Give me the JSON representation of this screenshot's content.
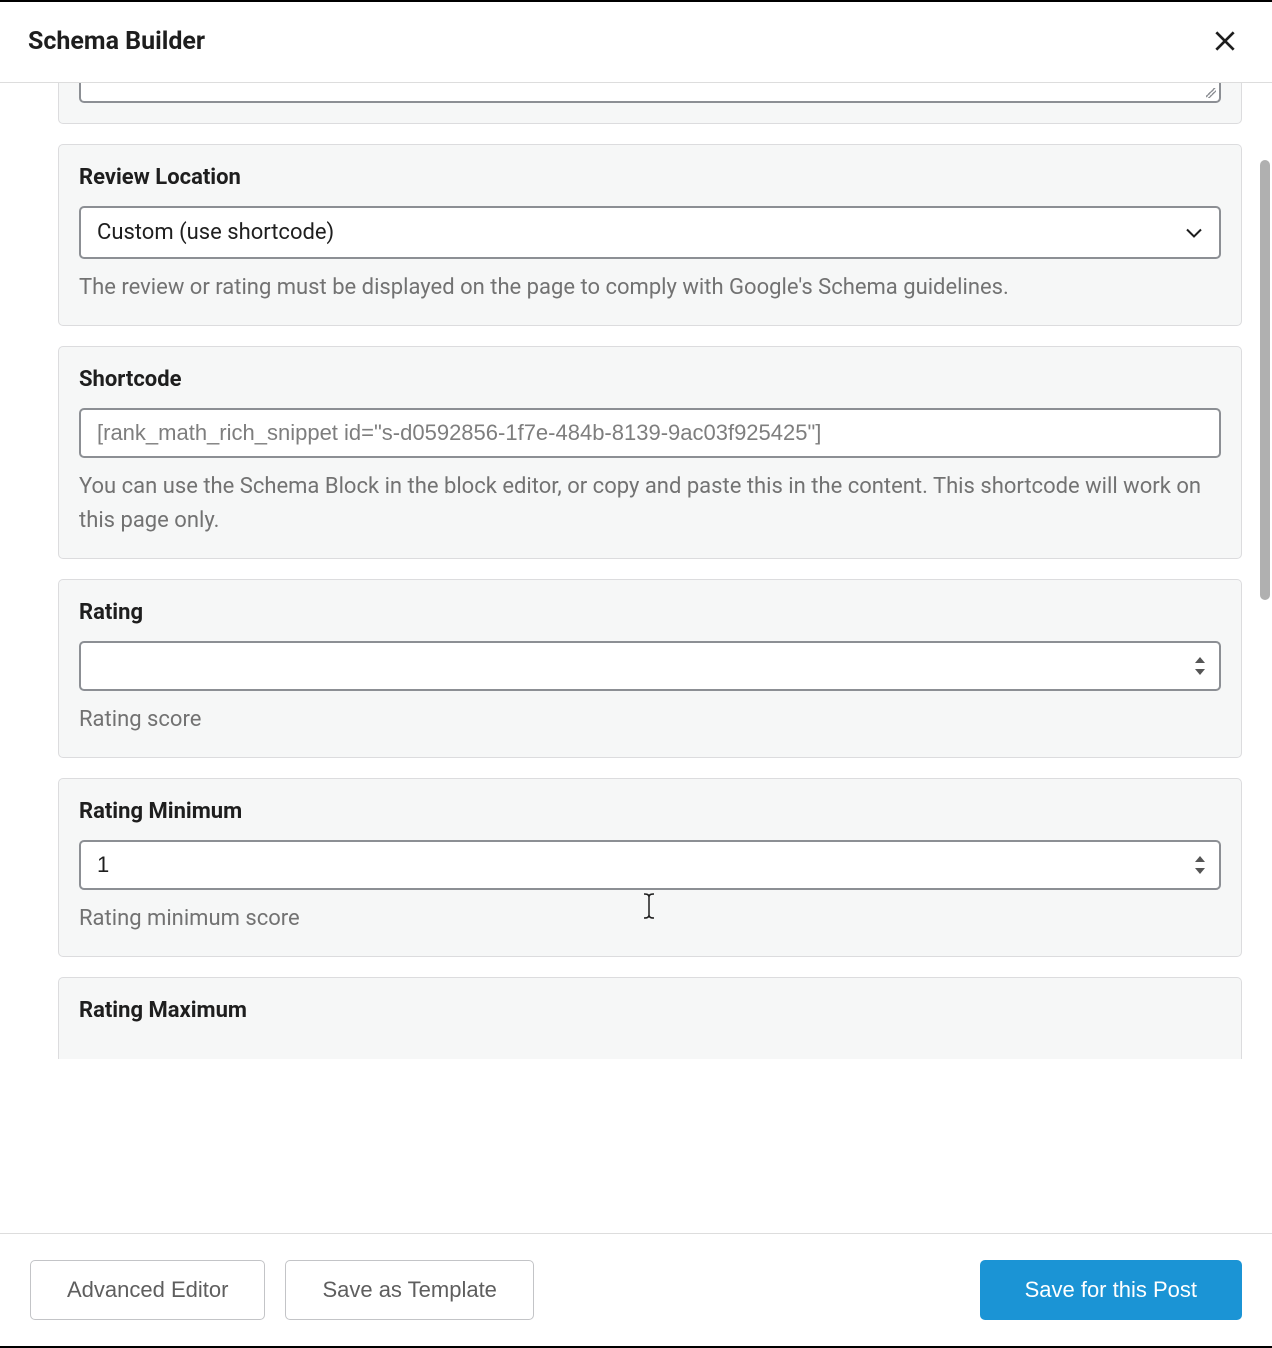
{
  "header": {
    "title": "Schema Builder"
  },
  "sections": {
    "reviewLocation": {
      "label": "Review Location",
      "selected": "Custom (use shortcode)",
      "help": "The review or rating must be displayed on the page to comply with Google's Schema guidelines."
    },
    "shortcode": {
      "label": "Shortcode",
      "value": "[rank_math_rich_snippet id=\"s-d0592856-1f7e-484b-8139-9ac03f925425\"]",
      "help": "You can use the Schema Block in the block editor, or copy and paste this in the content. This shortcode will work on this page only."
    },
    "rating": {
      "label": "Rating",
      "value": "",
      "help": "Rating score"
    },
    "ratingMin": {
      "label": "Rating Minimum",
      "value": "1",
      "help": "Rating minimum score"
    },
    "ratingMax": {
      "label": "Rating Maximum"
    }
  },
  "footer": {
    "advancedEditor": "Advanced Editor",
    "saveTemplate": "Save as Template",
    "savePost": "Save for this Post"
  }
}
